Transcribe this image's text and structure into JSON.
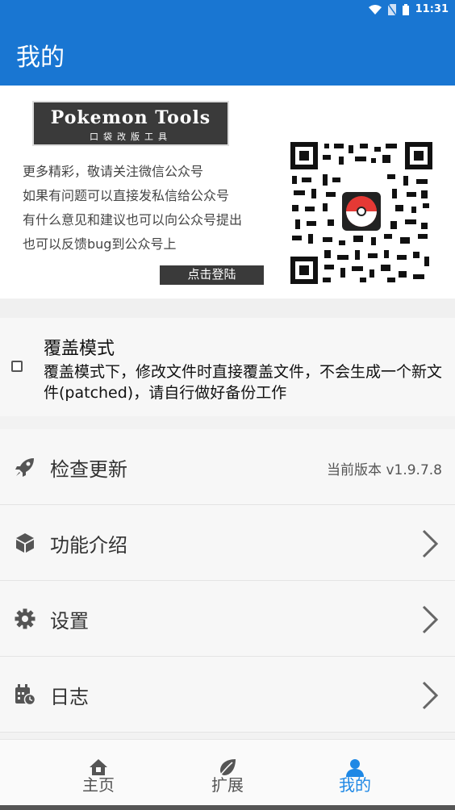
{
  "status_bar": {
    "time": "11:31",
    "accent": "#1976d2"
  },
  "app_bar": {
    "title": "我的"
  },
  "banner": {
    "logo_title": "Pokemon Tools",
    "logo_subtitle": "口袋改版工具",
    "lines": [
      "更多精彩，敬请关注微信公众号",
      "如果有问题可以直接发私信给公众号",
      "有什么意见和建议也可以向公众号提出",
      "也可以反馈bug到公众号上"
    ],
    "login_label": "点击登陆"
  },
  "cover_mode": {
    "title": "覆盖模式",
    "description": "覆盖模式下，修改文件时直接覆盖文件，不会生成一个新文件(patched)，请自行做好备份工作",
    "checked": false
  },
  "menu": {
    "update": {
      "label": "检查更新",
      "value": "当前版本 v1.9.7.8",
      "icon": "rocket-icon"
    },
    "features": {
      "label": "功能介绍",
      "icon": "cube-icon"
    },
    "settings": {
      "label": "设置",
      "icon": "gear-icon"
    },
    "log": {
      "label": "日志",
      "icon": "calendar-clock-icon"
    }
  },
  "bottom_nav": {
    "items": [
      {
        "label": "主页",
        "icon": "home-icon"
      },
      {
        "label": "扩展",
        "icon": "leaf-icon"
      },
      {
        "label": "我的",
        "icon": "person-icon",
        "active": true
      }
    ],
    "active_color": "#1e88e5"
  }
}
